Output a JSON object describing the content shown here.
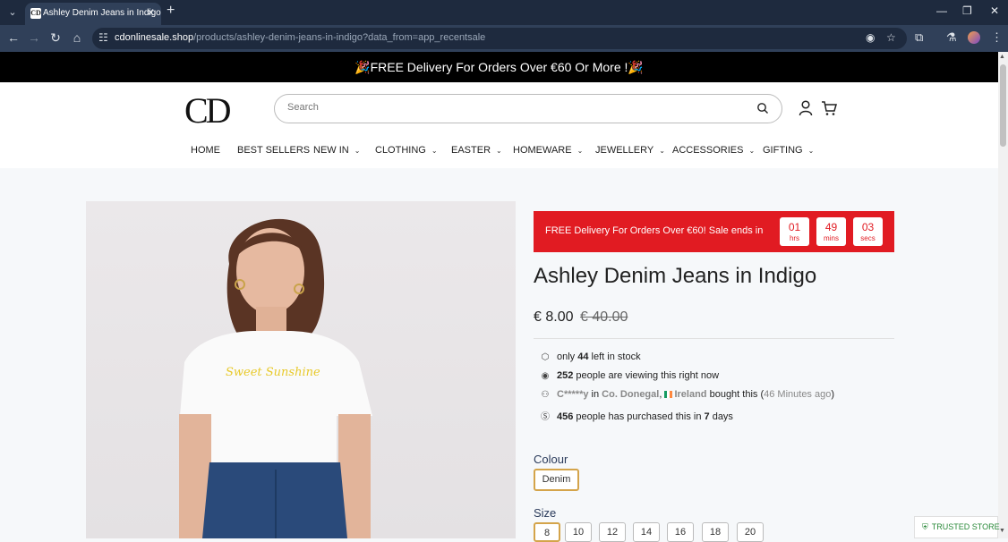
{
  "browser": {
    "tab_title": "Ashley Denim Jeans in Indigo",
    "tab_favicon": "CD",
    "url_host": "cdonlinesale.shop",
    "url_path": "/products/ashley-denim-jeans-in-indigo?data_from=app_recentsale"
  },
  "promo": {
    "text": "🎉FREE Delivery For Orders Over €60 Or More !🎉"
  },
  "header": {
    "logo": "CD",
    "search_placeholder": "Search"
  },
  "nav": {
    "items": [
      {
        "label": "HOME"
      },
      {
        "label": "BEST SELLERS"
      },
      {
        "label": "NEW IN"
      },
      {
        "label": "CLOTHING"
      },
      {
        "label": "EASTER"
      },
      {
        "label": "HOMEWARE"
      },
      {
        "label": "JEWELLERY"
      },
      {
        "label": "ACCESSORIES"
      },
      {
        "label": "GIFTING"
      }
    ]
  },
  "sale": {
    "text": "FREE Delivery For Orders Over €60!  Sale ends in",
    "countdown": [
      {
        "num": "01",
        "unit": "hrs"
      },
      {
        "num": "49",
        "unit": "mins"
      },
      {
        "num": "03",
        "unit": "secs"
      }
    ]
  },
  "product": {
    "title": "Ashley Denim Jeans in Indigo",
    "price": "€ 8.00",
    "old_price": "€ 40.00",
    "stock_pre": "only ",
    "stock_count": "44",
    "stock_post": " left in stock",
    "viewing_count": "252",
    "viewing_post": " people are viewing this right now",
    "buyer_name": "C*****y",
    "buyer_in": " in ",
    "buyer_place": "Co. Donegal",
    "buyer_country": "Ireland",
    "buyer_post": " bought this (",
    "buyer_time": "46 Minutes ago",
    "buyer_close": ")",
    "purchased_count": "456",
    "purchased_mid": " people has purchased this in ",
    "purchased_days": "7",
    "purchased_post": " days",
    "shirt_text": "Sweet Sunshine",
    "colour_label": "Colour",
    "colour_selected": "Denim",
    "size_label": "Size",
    "sizes": [
      "8",
      "10",
      "12",
      "14",
      "16",
      "18",
      "20"
    ]
  },
  "trust": {
    "label": "TRUSTED STORE"
  },
  "colors": {
    "sale_red": "#e11b22",
    "accent_gold": "#d4a44a",
    "header_dark": "#1e2a3e"
  }
}
